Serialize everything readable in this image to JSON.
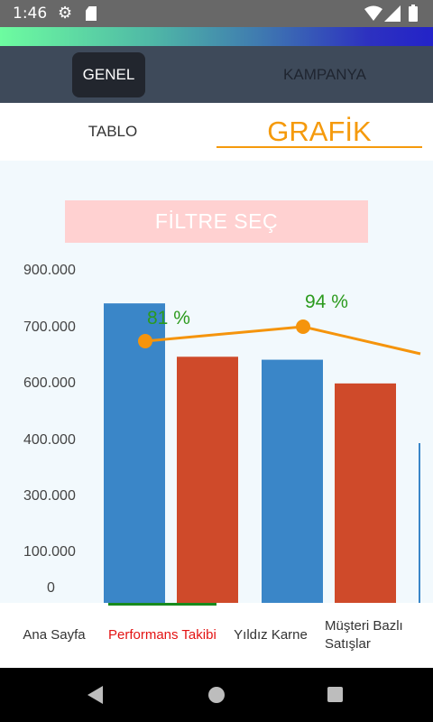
{
  "status_bar": {
    "time": "1:46"
  },
  "top_tabs": {
    "genel": "GENEL",
    "kampanya": "KAMPANYA"
  },
  "sub_tabs": {
    "tablo": "TABLO",
    "grafik": "GRAFİK"
  },
  "filter": {
    "label": "FİLTRE SEÇ"
  },
  "chart_data": {
    "type": "bar",
    "y_ticks": [
      "900.000",
      "700.000",
      "600.000",
      "400.000",
      "300.000",
      "100.000",
      "0"
    ],
    "series": [
      {
        "color": "#3a86c8",
        "values": [
          1010000,
          820000
        ]
      },
      {
        "color": "#cf4a2a",
        "values": [
          830000,
          740000
        ]
      }
    ],
    "percentages": [
      "81 %",
      "94 %"
    ],
    "line": {
      "color": "#f5940c",
      "points": [
        0.81,
        0.94
      ]
    },
    "label_color": "#2b9a1d",
    "ylim": [
      0,
      1050000
    ]
  },
  "bottom_nav": {
    "home": "Ana Sayfa",
    "performance": "Performans Takibi",
    "star_card": "Yıldız Karne",
    "customer_sales": "Müşteri Bazlı Satışlar"
  },
  "colors": {
    "accent": "#f59a0c",
    "active_nav": "#e31313",
    "nav_underline": "#188a1d"
  }
}
